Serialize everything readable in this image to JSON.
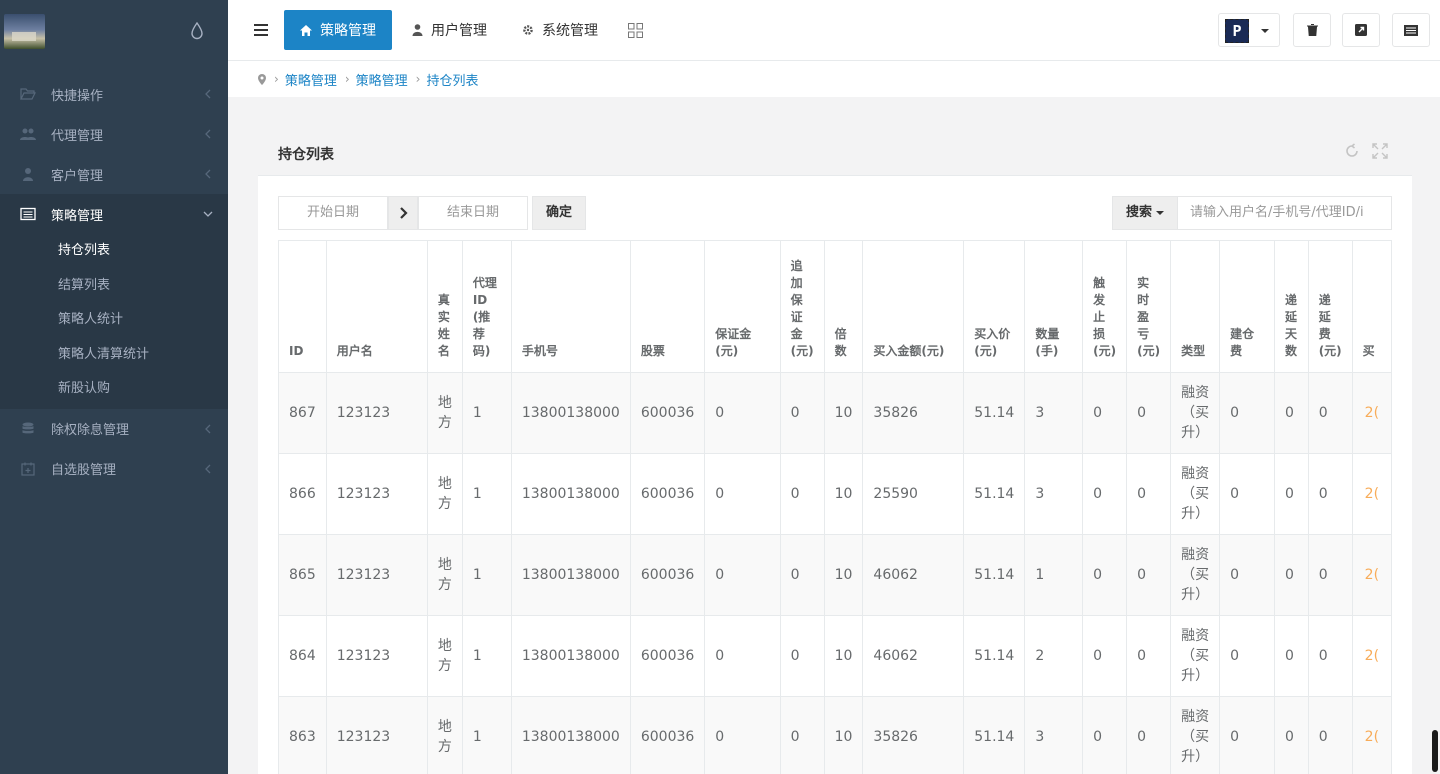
{
  "sidebar": {
    "logo": "logo-image",
    "items": [
      {
        "label": "快捷操作",
        "icon": "folder-open-icon"
      },
      {
        "label": "代理管理",
        "icon": "users-icon"
      },
      {
        "label": "客户管理",
        "icon": "user-icon"
      },
      {
        "label": "策略管理",
        "icon": "list-alt-icon",
        "active": true
      },
      {
        "label": "除权除息管理",
        "icon": "database-icon"
      },
      {
        "label": "自选股管理",
        "icon": "calendar-plus-icon"
      }
    ],
    "submenu": [
      "持仓列表",
      "结算列表",
      "策略人统计",
      "策略人清算统计",
      "新股认购"
    ]
  },
  "topbar": {
    "tabs": [
      {
        "label": "策略管理",
        "icon": "home-icon"
      },
      {
        "label": "用户管理",
        "icon": "user-icon"
      },
      {
        "label": "系统管理",
        "icon": "gear-icon"
      }
    ],
    "avatar_letter": "P"
  },
  "breadcrumb": [
    "策略管理",
    "策略管理",
    "持仓列表"
  ],
  "panel": {
    "title": "持仓列表",
    "date_start_placeholder": "开始日期",
    "date_end_placeholder": "结束日期",
    "confirm_label": "确定",
    "search_label": "搜索",
    "search_placeholder": "请输入用户名/手机号/代理ID/i"
  },
  "table": {
    "headers": [
      "ID",
      "用户名",
      "真实姓名",
      "代理ID(推荐码)",
      "手机号",
      "股票",
      "保证金(元)",
      "追加保证金(元)",
      "倍数",
      "买入金额(元)",
      "买入价(元)",
      "数量(手)",
      "触发止损(元)",
      "实时盈亏(元)",
      "类型",
      "建仓费",
      "递延天数",
      "递延费(元)",
      "买"
    ],
    "rows": [
      [
        "867",
        "123123",
        "地方",
        "1",
        "13800138000",
        "600036",
        "0",
        "0",
        "10",
        "35826",
        "51.14",
        "3",
        "0",
        "0",
        "融资（买升）",
        "0",
        "0",
        "0",
        "2("
      ],
      [
        "866",
        "123123",
        "地方",
        "1",
        "13800138000",
        "600036",
        "0",
        "0",
        "10",
        "25590",
        "51.14",
        "3",
        "0",
        "0",
        "融资（买升）",
        "0",
        "0",
        "0",
        "2("
      ],
      [
        "865",
        "123123",
        "地方",
        "1",
        "13800138000",
        "600036",
        "0",
        "0",
        "10",
        "46062",
        "51.14",
        "1",
        "0",
        "0",
        "融资（买升）",
        "0",
        "0",
        "0",
        "2("
      ],
      [
        "864",
        "123123",
        "地方",
        "1",
        "13800138000",
        "600036",
        "0",
        "0",
        "10",
        "46062",
        "51.14",
        "2",
        "0",
        "0",
        "融资（买升）",
        "0",
        "0",
        "0",
        "2("
      ],
      [
        "863",
        "123123",
        "地方",
        "1",
        "13800138000",
        "600036",
        "0",
        "0",
        "10",
        "35826",
        "51.14",
        "3",
        "0",
        "0",
        "融资（买升）",
        "0",
        "0",
        "0",
        "2("
      ]
    ]
  }
}
